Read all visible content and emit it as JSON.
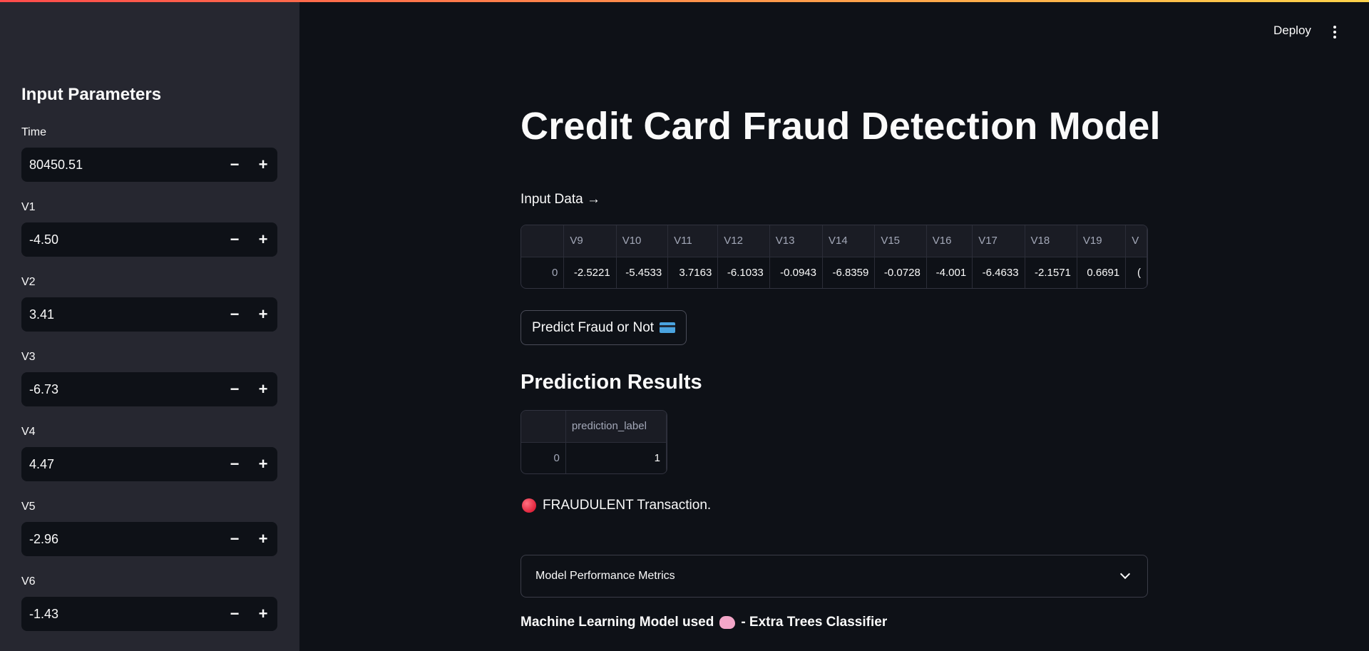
{
  "header": {
    "deploy_label": "Deploy",
    "menu_icon": "more-vert-icon"
  },
  "sidebar": {
    "title": "Input Parameters",
    "params": [
      {
        "label": "Time",
        "value": "80450.51"
      },
      {
        "label": "V1",
        "value": "-4.50"
      },
      {
        "label": "V2",
        "value": "3.41"
      },
      {
        "label": "V3",
        "value": "-6.73"
      },
      {
        "label": "V4",
        "value": "4.47"
      },
      {
        "label": "V5",
        "value": "-2.96"
      },
      {
        "label": "V6",
        "value": "-1.43"
      }
    ],
    "minus_label": "−",
    "plus_label": "+"
  },
  "main": {
    "title": "Credit Card Fraud Detection Model",
    "input_data_label": "Input Data →",
    "input_table": {
      "columns": [
        "",
        "V9",
        "V10",
        "V11",
        "V12",
        "V13",
        "V14",
        "V15",
        "V16",
        "V17",
        "V18",
        "V19",
        "V"
      ],
      "rows": [
        [
          "0",
          "-2.5221",
          "-5.4533",
          "3.7163",
          "-6.1033",
          "-0.0943",
          "-6.8359",
          "-0.0728",
          "-4.001",
          "-6.4633",
          "-2.1571",
          "0.6691",
          "("
        ]
      ]
    },
    "predict_button": "Predict Fraud or Not",
    "results_title": "Prediction Results",
    "prediction_table": {
      "columns": [
        "",
        "prediction_label"
      ],
      "rows": [
        [
          "0",
          "1"
        ]
      ]
    },
    "result_text": "FRAUDULENT Transaction.",
    "expander_label": "Model Performance Metrics",
    "model_prefix": "Machine Learning Model used",
    "model_suffix": "- Extra Trees Classifier"
  },
  "colors": {
    "background": "#0e1117",
    "sidebar": "#262730",
    "accent_red": "#ff4b4b"
  }
}
